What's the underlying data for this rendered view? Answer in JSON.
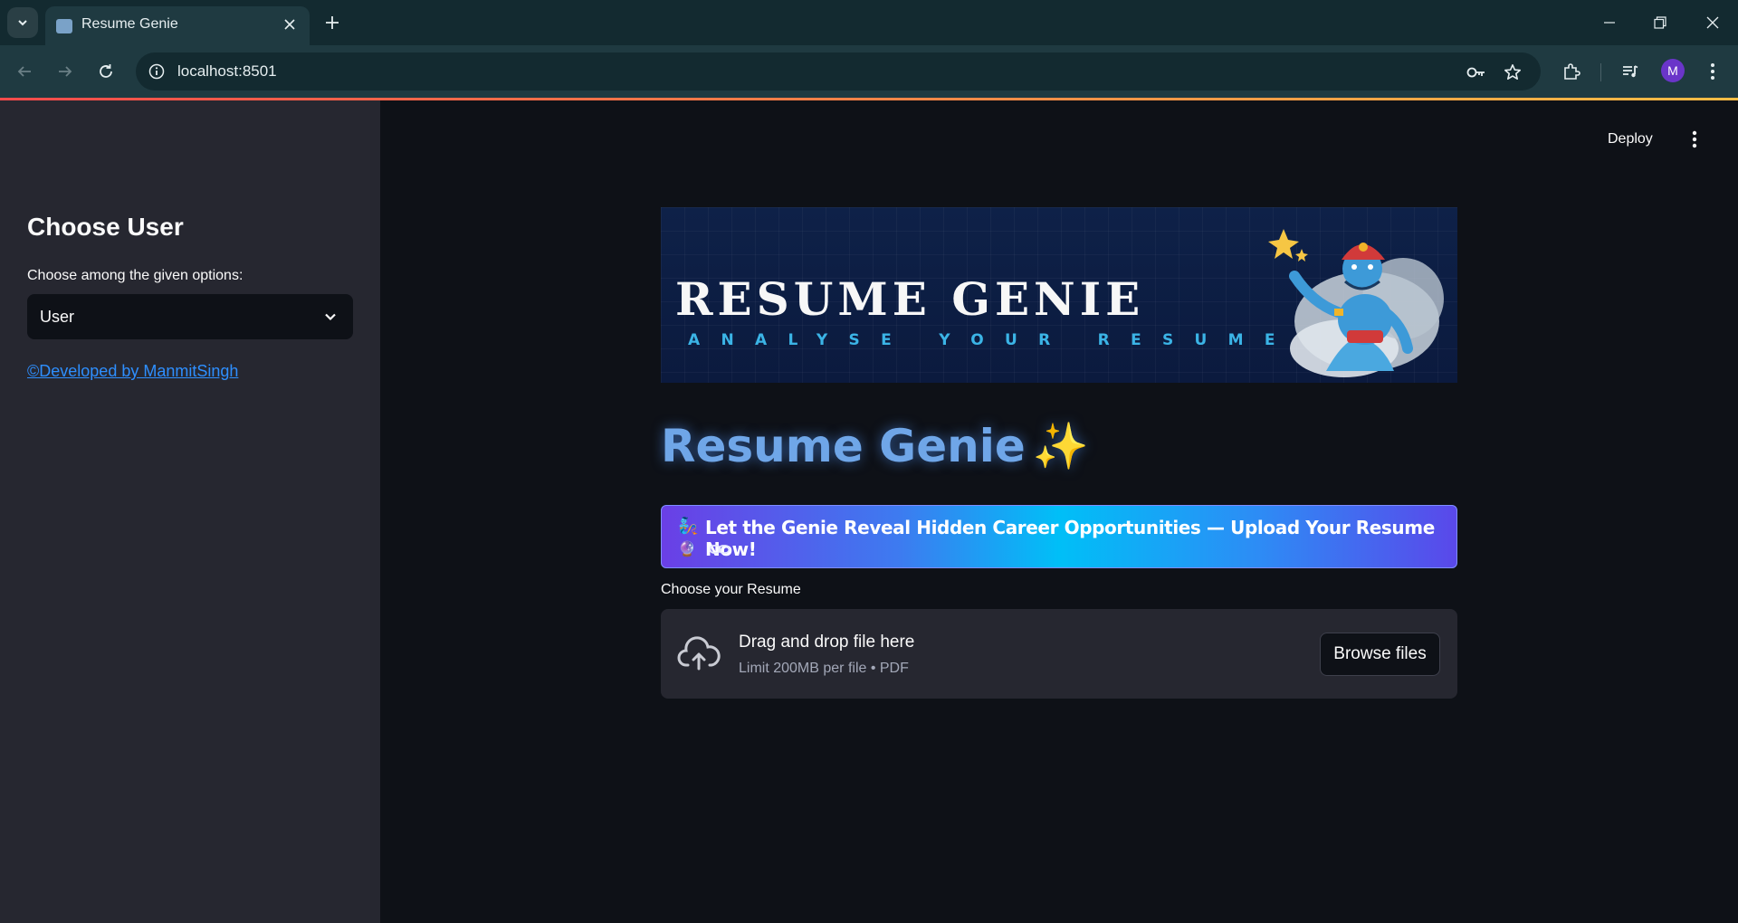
{
  "browser": {
    "tab_title": "Resume Genie",
    "url": "localhost:8501",
    "profile_initial": "M"
  },
  "sidebar": {
    "title": "Choose User",
    "select_label": "Choose among the given options:",
    "select_value": "User",
    "credit_link": "©Developed by ManmitSingh"
  },
  "header": {
    "deploy_label": "Deploy"
  },
  "banner": {
    "title": "RESUME GENIE",
    "subtitle": "ANALYSE YOUR RESUME"
  },
  "main": {
    "title": "Resume Genie",
    "title_emoji": "✨",
    "cta_emoji": "🧞",
    "cta_text": "Let the Genie Reveal Hidden Career Opportunities — Upload Your Resume Now!",
    "cta_emoji2": "🔮",
    "uploader_label": "Choose your Resume",
    "uploader_main": "Drag and drop file here",
    "uploader_sub": "Limit 200MB per file • PDF",
    "browse_label": "Browse files"
  },
  "colors": {
    "accent_link": "#2e8fff",
    "sidebar_bg": "#262730",
    "main_bg": "#0e1117"
  }
}
